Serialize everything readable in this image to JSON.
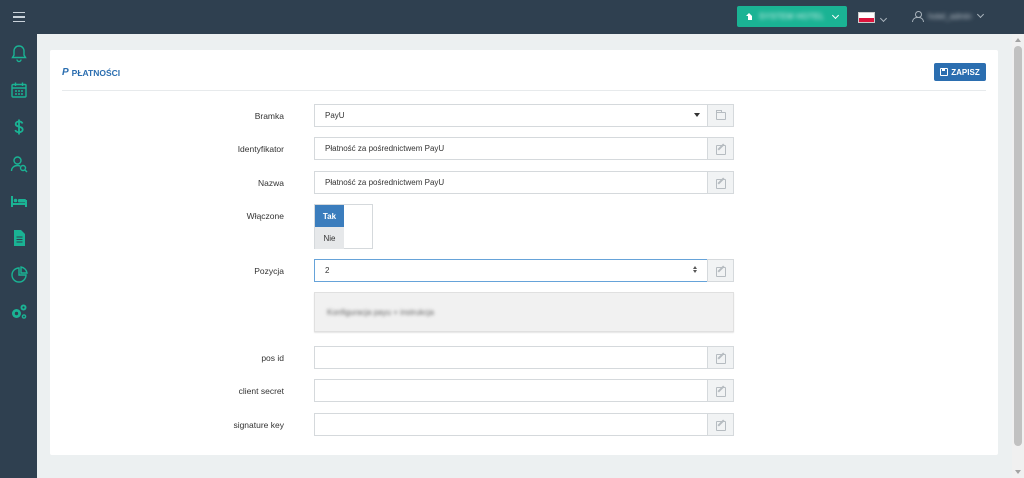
{
  "topbar": {
    "hotel_button_label": "SYSTEM HOTEL",
    "user_label": "hotel_admin"
  },
  "sidebar": {
    "items": [
      {
        "icon": "bell-icon"
      },
      {
        "icon": "calendar-icon"
      },
      {
        "icon": "dollar-icon"
      },
      {
        "icon": "user-search-icon"
      },
      {
        "icon": "bed-icon"
      },
      {
        "icon": "document-icon"
      },
      {
        "icon": "chart-pie-icon"
      },
      {
        "icon": "cogs-icon"
      }
    ]
  },
  "panel": {
    "title_icon": "PayPal",
    "title": "PŁATNOŚCI",
    "save_label": "ZAPISZ"
  },
  "form": {
    "gateway": {
      "label": "Bramka",
      "value": "PayU"
    },
    "identifier": {
      "label": "Identyfikator",
      "value": "Płatność za pośrednictwem PayU"
    },
    "name": {
      "label": "Nazwa",
      "value": "Płatność za pośrednictwem PayU"
    },
    "enabled": {
      "label": "Włączone",
      "on_label": "Tak",
      "off_label": "Nie"
    },
    "position": {
      "label": "Pozycja",
      "value": "2"
    },
    "info_text": "Konfiguracja payu + instrukcja",
    "pos_id": {
      "label": "pos id",
      "value": ""
    },
    "client_secret": {
      "label": "client secret",
      "value": ""
    },
    "signature_key": {
      "label": "signature key",
      "value": ""
    }
  },
  "colors": {
    "sidebar_bg": "#2f4050",
    "accent_green": "#1ab394",
    "primary_blue": "#2b6eb0"
  }
}
